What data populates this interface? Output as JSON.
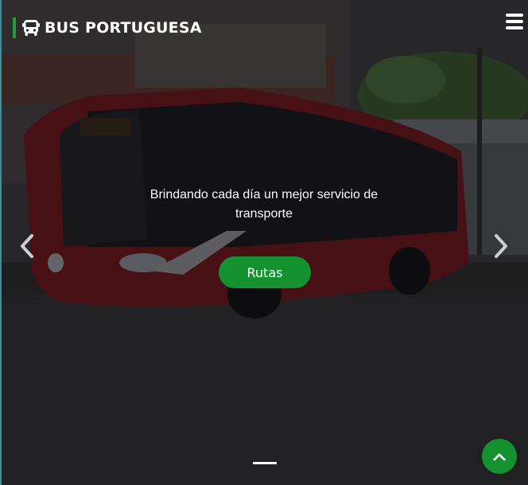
{
  "brand": {
    "name": "BUS PORTUGUESA",
    "icon": "bus-icon"
  },
  "nav": {
    "menu_icon": "hamburger-menu-icon"
  },
  "carousel": {
    "caption": "Brindando cada día un mejor servicio de transporte",
    "cta_label": "Rutas",
    "prev_icon": "chevron-left-icon",
    "next_icon": "chevron-right-icon",
    "active_slide": 1,
    "slide_count": 1
  },
  "back_to_top": {
    "icon": "chevron-up-icon"
  },
  "colors": {
    "accent": "#13922f",
    "brand_bar": "#1e9e3f"
  }
}
